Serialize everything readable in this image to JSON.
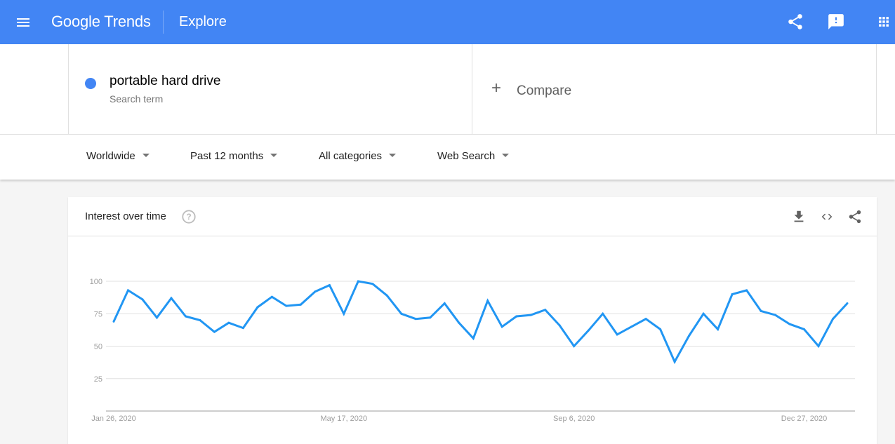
{
  "header": {
    "logo_google": "Google",
    "logo_trends": "Trends",
    "page": "Explore",
    "icons": [
      "menu-icon",
      "share-icon",
      "feedback-icon",
      "apps-icon"
    ],
    "bar_color": "#4285f4"
  },
  "search": {
    "term": "portable hard drive",
    "term_sublabel": "Search term",
    "term_color": "#4285f4",
    "compare_plus": "+",
    "compare_label": "Compare"
  },
  "filters": {
    "region": "Worldwide",
    "time_range": "Past 12 months",
    "category": "All categories",
    "search_type": "Web Search"
  },
  "card": {
    "title": "Interest over time",
    "actions": [
      "download-icon",
      "embed-icon",
      "share-icon"
    ]
  },
  "chart_data": {
    "type": "line",
    "title": "Interest over time",
    "xlabel": "",
    "ylabel": "",
    "ylim": [
      0,
      100
    ],
    "yticks": [
      25,
      50,
      75,
      100
    ],
    "xtick_labels": [
      "Jan 26, 2020",
      "May 17, 2020",
      "Sep 6, 2020",
      "Dec 27, 2020"
    ],
    "xtick_indices": [
      0,
      16,
      32,
      48
    ],
    "grid": true,
    "legend": "none",
    "series": [
      {
        "name": "portable hard drive",
        "color": "#2196f3",
        "values": [
          69,
          93,
          86,
          72,
          87,
          73,
          70,
          61,
          68,
          64,
          80,
          88,
          81,
          82,
          92,
          97,
          75,
          100,
          98,
          89,
          75,
          71,
          72,
          83,
          68,
          56,
          85,
          65,
          73,
          74,
          78,
          66,
          50,
          62,
          75,
          59,
          65,
          71,
          63,
          38,
          58,
          75,
          63,
          90,
          93,
          77,
          74,
          67,
          63,
          50,
          71,
          83
        ]
      }
    ]
  }
}
